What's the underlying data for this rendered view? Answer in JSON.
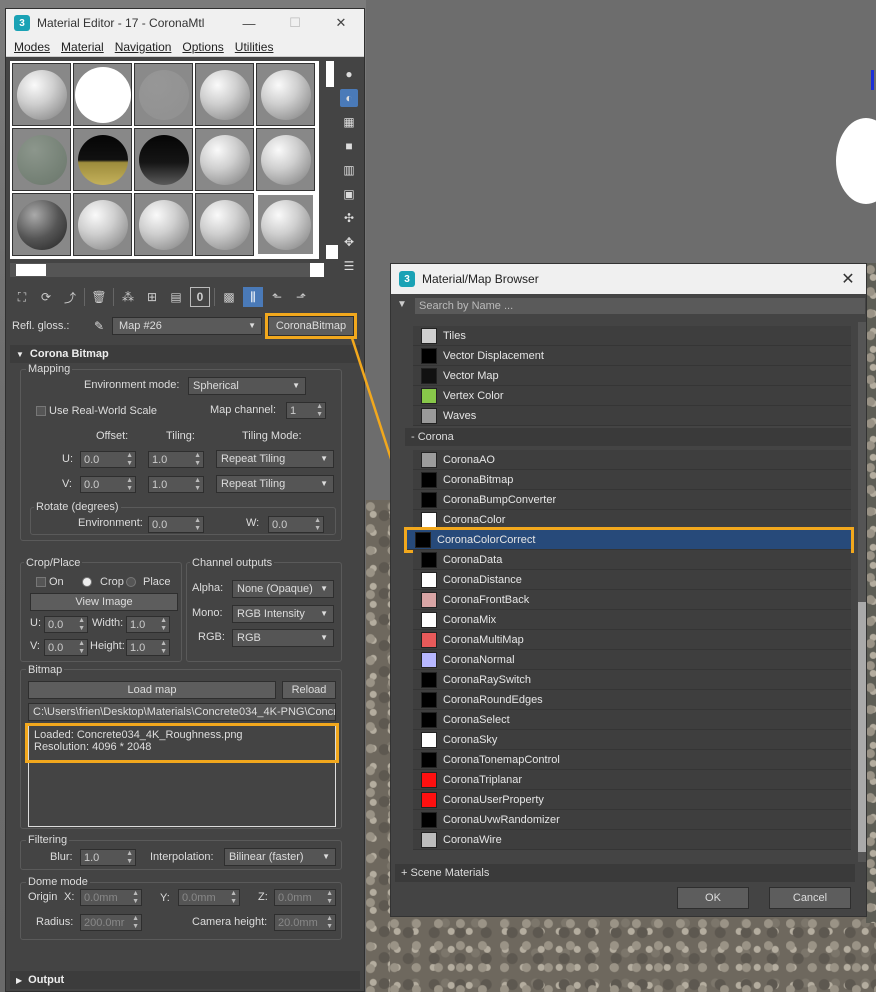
{
  "material_editor": {
    "title": "Material Editor - 17 - CoronaMtl",
    "app_icon": "3",
    "minimize_glyph": "—",
    "maximize_glyph": "☐",
    "close_glyph": "✕",
    "menu": [
      "Modes",
      "Material",
      "Navigation",
      "Options",
      "Utilities"
    ],
    "param_label": "Refl. gloss.:",
    "map_name": "Map #26",
    "map_type": "CoronaBitmap",
    "rollout_title": "Corona Bitmap",
    "mapping": {
      "group": "Mapping",
      "env_mode_label": "Environment mode:",
      "env_mode_value": "Spherical",
      "real_world_label": "Use Real-World Scale",
      "map_channel_label": "Map channel:",
      "map_channel_value": "1",
      "offset_label": "Offset:",
      "tiling_label": "Tiling:",
      "tiling_mode_label": "Tiling Mode:",
      "u_label": "U:",
      "v_label": "V:",
      "u_offset": "0.0",
      "u_tiling": "1.0",
      "u_mode": "Repeat Tiling",
      "v_offset": "0.0",
      "v_tiling": "1.0",
      "v_mode": "Repeat Tiling",
      "rotate_label": "Rotate (degrees)",
      "environment_label": "Environment:",
      "environment_value": "0.0",
      "w_label": "W:",
      "w_value": "0.0"
    },
    "crop": {
      "group": "Crop/Place",
      "on_label": "On",
      "crop_label": "Crop",
      "place_label": "Place",
      "view_image": "View Image",
      "u_label": "U:",
      "u_value": "0.0",
      "width_label": "Width:",
      "width_value": "1.0",
      "v_label": "V:",
      "v_value": "0.0",
      "height_label": "Height:",
      "height_value": "1.0"
    },
    "channels": {
      "group": "Channel outputs",
      "alpha_label": "Alpha:",
      "alpha_value": "None (Opaque)",
      "mono_label": "Mono:",
      "mono_value": "RGB Intensity",
      "rgb_label": "RGB:",
      "rgb_value": "RGB"
    },
    "bitmap": {
      "group": "Bitmap",
      "load_map": "Load map",
      "reload": "Reload",
      "path": "C:\\Users\\frien\\Desktop\\Materials\\Concrete034_4K-PNG\\Concre",
      "loaded": "Loaded: Concrete034_4K_Roughness.png",
      "resolution": "Resolution: 4096 * 2048"
    },
    "filtering": {
      "group": "Filtering",
      "blur_label": "Blur:",
      "blur_value": "1.0",
      "interp_label": "Interpolation:",
      "interp_value": "Bilinear (faster)"
    },
    "dome": {
      "group": "Dome mode",
      "origin_label": "Origin",
      "x_label": "X:",
      "x_value": "0.0mm",
      "y_label": "Y:",
      "y_value": "0.0mm",
      "z_label": "Z:",
      "z_value": "0.0mm",
      "radius_label": "Radius:",
      "radius_value": "200.0mr",
      "camera_label": "Camera height:",
      "camera_value": "20.0mm"
    },
    "output_rollout": "Output"
  },
  "browser": {
    "title": "Material/Map Browser",
    "app_icon": "3",
    "close_glyph": "✕",
    "search_placeholder": "Search by Name ...",
    "items_before": [
      {
        "name": "Tiles",
        "color": "#cfcfcf"
      },
      {
        "name": "Vector Displacement",
        "color": "#000000"
      },
      {
        "name": "Vector Map",
        "color": "#111111"
      },
      {
        "name": "Vertex Color",
        "color": "#88c84a"
      },
      {
        "name": "Waves",
        "color": "#9a9a9a"
      }
    ],
    "category": "- Corona",
    "corona_items": [
      {
        "name": "CoronaAO",
        "color": "#9b9b9b"
      },
      {
        "name": "CoronaBitmap",
        "color": "#000000"
      },
      {
        "name": "CoronaBumpConverter",
        "color": "#000000"
      },
      {
        "name": "CoronaColor",
        "color": "#ffffff"
      },
      {
        "name": "CoronaColorCorrect",
        "color": "#000000"
      },
      {
        "name": "CoronaData",
        "color": "#000000"
      },
      {
        "name": "CoronaDistance",
        "color": "#ffffff"
      },
      {
        "name": "CoronaFrontBack",
        "color": "#d9a5a5"
      },
      {
        "name": "CoronaMix",
        "color": "#ffffff"
      },
      {
        "name": "CoronaMultiMap",
        "color": "#e85a5a"
      },
      {
        "name": "CoronaNormal",
        "color": "#b7b7ff"
      },
      {
        "name": "CoronaRaySwitch",
        "color": "#000000"
      },
      {
        "name": "CoronaRoundEdges",
        "color": "#000000"
      },
      {
        "name": "CoronaSelect",
        "color": "#000000"
      },
      {
        "name": "CoronaSky",
        "color": "#ffffff"
      },
      {
        "name": "CoronaTonemapControl",
        "color": "#000000"
      },
      {
        "name": "CoronaTriplanar",
        "color": "#ff1010"
      },
      {
        "name": "CoronaUserProperty",
        "color": "#ff1010"
      },
      {
        "name": "CoronaUvwRandomizer",
        "color": "#000000"
      },
      {
        "name": "CoronaWire",
        "color": "#bdbdbd"
      }
    ],
    "selected": "CoronaColorCorrect",
    "scene_materials": "+ Scene Materials",
    "ok": "OK",
    "cancel": "Cancel"
  },
  "colors": {
    "highlight": "#f2a81d",
    "selection": "#274a7a",
    "active_tool": "#4a7ab8"
  }
}
